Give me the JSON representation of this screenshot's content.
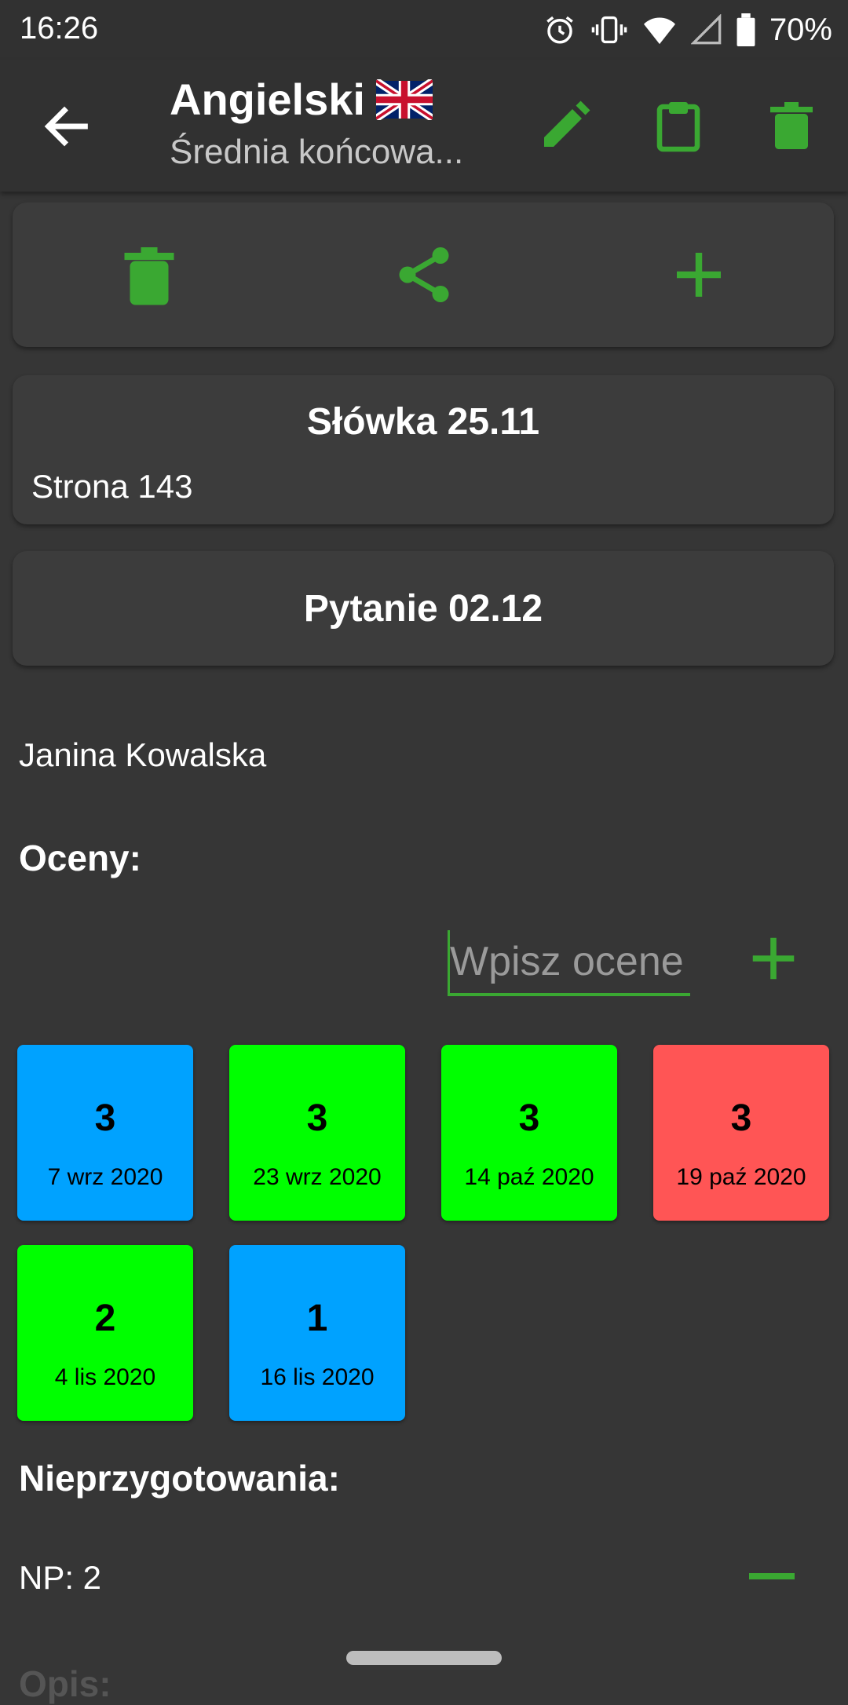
{
  "status_bar": {
    "time": "16:26",
    "battery": "70%"
  },
  "app_bar": {
    "title": "Angielski",
    "subtitle": "Średnia końcowa..."
  },
  "notes": [
    {
      "title": "Słówka 25.11",
      "body": "Strona 143"
    },
    {
      "title": "Pytanie 02.12"
    }
  ],
  "teacher": "Janina Kowalska",
  "grades_section": {
    "label": "Oceny:",
    "input_placeholder": "Wpisz ocene",
    "tiles": [
      {
        "value": "3",
        "date": "7 wrz 2020",
        "color": "#00a2ff"
      },
      {
        "value": "3",
        "date": "23 wrz 2020",
        "color": "#00ff00"
      },
      {
        "value": "3",
        "date": "14 paź 2020",
        "color": "#00ff00"
      },
      {
        "value": "3",
        "date": "19 paź 2020",
        "color": "#ff5555"
      },
      {
        "value": "2",
        "date": "4 lis 2020",
        "color": "#00ff00"
      },
      {
        "value": "1",
        "date": "16 lis 2020",
        "color": "#00a2ff"
      }
    ]
  },
  "unprepared_section": {
    "label": "Nieprzygotowania:",
    "count_text": "NP: 2"
  },
  "description_section": {
    "label": "Opis:"
  },
  "colors": {
    "accent": "#3aa832",
    "background": "#363636",
    "card": "#3c3c3c"
  },
  "icons": [
    "back-arrow-icon",
    "flag-uk-icon",
    "pencil-icon",
    "clipboard-icon",
    "trash-icon",
    "share-icon",
    "plus-icon",
    "minus-icon"
  ]
}
